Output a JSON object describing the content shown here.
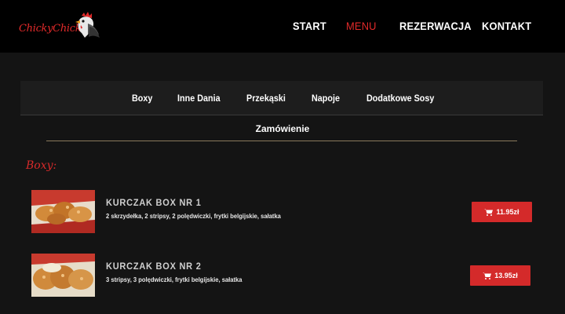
{
  "brand": {
    "logo_text": "ChickyChicken"
  },
  "nav": {
    "items": [
      {
        "label": "START",
        "active": false
      },
      {
        "label": "MENU",
        "active": true
      },
      {
        "label": "REZERWACJA",
        "active": false
      },
      {
        "label": "KONTAKT",
        "active": false
      }
    ]
  },
  "categories": {
    "tabs": [
      "Boxy",
      "Inne Dania",
      "Przekąski",
      "Napoje",
      "Dodatkowe Sosy"
    ],
    "order_tab": "Zamówienie"
  },
  "section": {
    "title": "Boxy:"
  },
  "products": [
    {
      "name": "KURCZAK BOX NR 1",
      "description": "2 skrzydełka, 2 stripsy, 2 polędwiczki, frytki belgijskie, sałatka",
      "price": "11.95zł"
    },
    {
      "name": "KURCZAK BOX NR 2",
      "description": "3 stripsy, 3 polędwiczki, frytki belgijskie, sałatka",
      "price": "13.95zł"
    }
  ],
  "colors": {
    "accent": "#d42a2a",
    "topbar": "#000000",
    "background": "#141414",
    "panel": "#1d1d1d"
  },
  "icons": {
    "cart": "cart-icon",
    "logo": "rooster-logo"
  }
}
